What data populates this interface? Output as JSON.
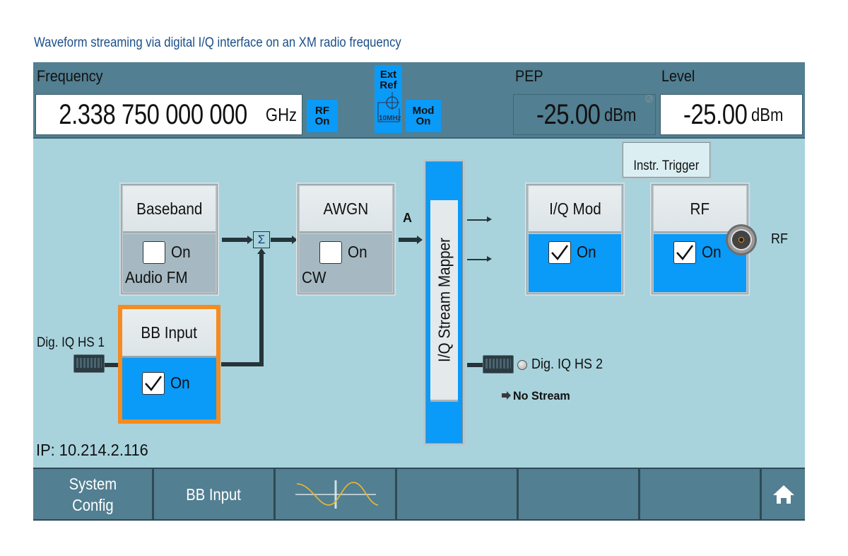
{
  "caption": "Waveform streaming via digital I/Q interface on an XM radio frequency",
  "header": {
    "frequency_label": "Frequency",
    "frequency_value": "2.338 750 000 000",
    "frequency_unit": "GHz",
    "rf_status": [
      "RF",
      "On"
    ],
    "ext_ref": [
      "Ext",
      "Ref"
    ],
    "ext_ref_freq": "10MHz",
    "mod_status": [
      "Mod",
      "On"
    ],
    "pep_label": "PEP",
    "pep_value": "-25.00",
    "pep_unit": "dBm",
    "level_label": "Level",
    "level_value": "-25.00",
    "level_unit": "dBm"
  },
  "diagram": {
    "baseband": {
      "title": "Baseband",
      "state_label": "On",
      "checked": false,
      "sub_label": "Audio FM"
    },
    "bb_input": {
      "title": "BB Input",
      "state_label": "On",
      "checked": true
    },
    "awgn": {
      "title": "AWGN",
      "state_label": "On",
      "checked": false,
      "sub_label": "CW"
    },
    "stream_label": "A",
    "sum_symbol": "Σ",
    "stream_mapper": "I/Q Stream Mapper",
    "iq_mod": {
      "title": "I/Q Mod",
      "state_label": "On",
      "checked": true
    },
    "rf": {
      "title": "RF",
      "state_label": "On",
      "checked": true
    },
    "instr_trigger": "Instr. Trigger",
    "rf_port_label": "RF",
    "dig_iq_hs1": "Dig. IQ HS 1",
    "dig_iq_hs2": "Dig. IQ HS 2",
    "no_stream": "No Stream",
    "ip": "IP: 10.214.2.116"
  },
  "toolbar": {
    "buttons": [
      {
        "label": "System\nConfig"
      },
      {
        "label": "BB Input"
      },
      {
        "label": "",
        "icon": "waveform-icon"
      },
      {
        "label": ""
      },
      {
        "label": ""
      },
      {
        "label": ""
      },
      {
        "label": "",
        "icon": "home-icon"
      }
    ]
  },
  "colors": {
    "accent_blue": "#0a9af8",
    "focus_orange": "#f68b1f",
    "panel": "#527f91",
    "background": "#a8d3dd"
  }
}
